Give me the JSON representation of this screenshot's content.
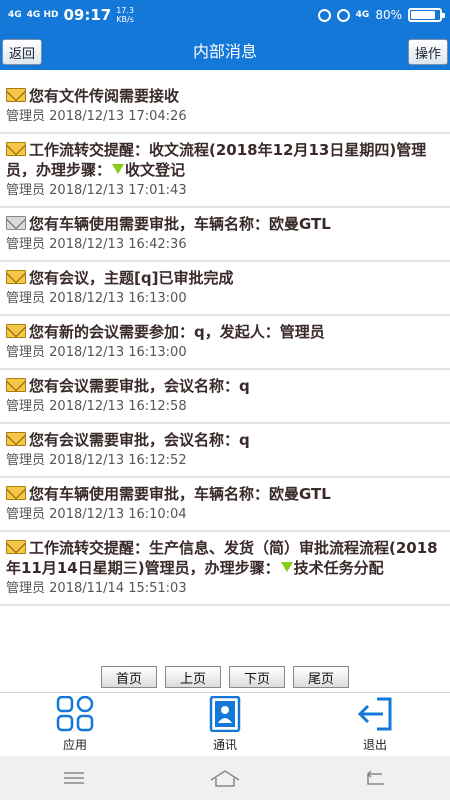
{
  "status_bar": {
    "signal_1": "4G",
    "signal_2": "4G HD",
    "time": "09:17",
    "speed_value": "17.3",
    "speed_unit": "KB/s",
    "network_right": "4G",
    "battery": "80%",
    "battery_level": 0.8
  },
  "header": {
    "back_label": "返回",
    "title": "内部消息",
    "action_label": "操作"
  },
  "messages": [
    {
      "icon": "mail-unread-icon",
      "title": "您有文件传阅需要接收",
      "sender": "管理员",
      "time": "2018/12/13 17:04:26"
    },
    {
      "icon": "mail-unread-icon",
      "title_part1": "工作流转交提醒：收文流程(2018年12月13日星期四)管理员，办理步骤：",
      "title_part2": "收文登记",
      "sender": "管理员",
      "time": "2018/12/13 17:01:43"
    },
    {
      "icon": "mail-read-icon",
      "title": "您有车辆使用需要审批，车辆名称：欧曼GTL",
      "sender": "管理员",
      "time": "2018/12/13 16:42:36"
    },
    {
      "icon": "mail-unread-icon",
      "title": "您有会议，主题[q]已审批完成",
      "sender": "管理员",
      "time": "2018/12/13 16:13:00"
    },
    {
      "icon": "mail-unread-icon",
      "title": "您有新的会议需要参加：q，发起人：管理员",
      "sender": "管理员",
      "time": "2018/12/13 16:13:00"
    },
    {
      "icon": "mail-unread-icon",
      "title": "您有会议需要审批，会议名称：q",
      "sender": "管理员",
      "time": "2018/12/13 16:12:58"
    },
    {
      "icon": "mail-unread-icon",
      "title": "您有会议需要审批，会议名称：q",
      "sender": "管理员",
      "time": "2018/12/13 16:12:52"
    },
    {
      "icon": "mail-unread-icon",
      "title": "您有车辆使用需要审批，车辆名称：欧曼GTL",
      "sender": "管理员",
      "time": "2018/12/13 16:10:04"
    },
    {
      "icon": "mail-unread-icon",
      "title_part1": "工作流转交提醒：生产信息、发货（简）审批流程流程(2018年11月14日星期三)管理员，办理步骤：",
      "title_part2": "技术任务分配",
      "sender": "管理员",
      "time": "2018/11/14 15:51:03"
    }
  ],
  "pager": {
    "first": "首页",
    "prev": "上页",
    "next": "下页",
    "last": "尾页"
  },
  "bottom_nav": {
    "apps": "应用",
    "contacts": "通讯",
    "exit": "退出"
  },
  "colors": {
    "primary": "#1478d8",
    "mail_icon": "#f5c844",
    "step_arrow": "#8acb1a"
  }
}
